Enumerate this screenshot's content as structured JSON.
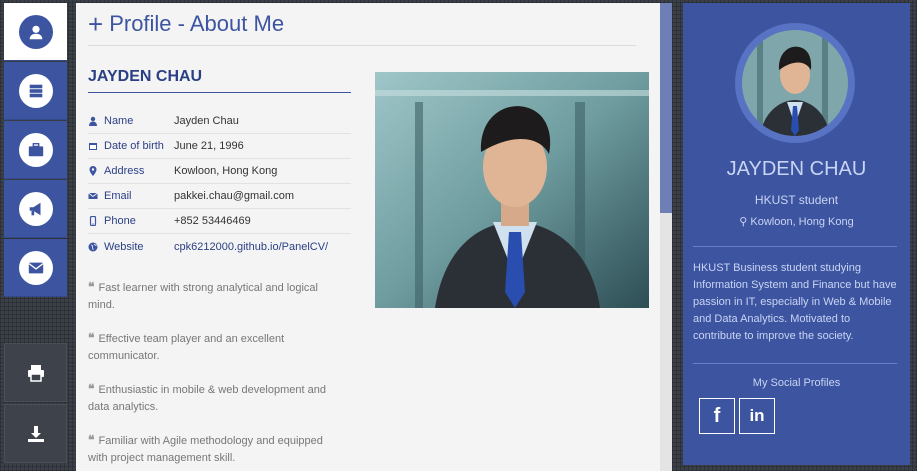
{
  "header": {
    "title": "Profile - About Me"
  },
  "profile": {
    "name": "JAYDEN CHAU",
    "fields": [
      {
        "icon": "user-icon",
        "label": "Name",
        "value": "Jayden Chau"
      },
      {
        "icon": "calendar-icon",
        "label": "Date of birth",
        "value": "June 21, 1996"
      },
      {
        "icon": "map-marker-icon",
        "label": "Address",
        "value": "Kowloon, Hong Kong"
      },
      {
        "icon": "envelope-icon",
        "label": "Email",
        "value": "pakkei.chau@gmail.com"
      },
      {
        "icon": "mobile-icon",
        "label": "Phone",
        "value": "+852 53446469"
      },
      {
        "icon": "globe-icon",
        "label": "Website",
        "value": "cpk6212000.github.io/PanelCV/"
      }
    ],
    "highlights": [
      "Fast learner with strong analytical and logical mind.",
      "Effective team player and an excellent communicator.",
      "Enthusiastic in mobile & web development and data analytics.",
      "Familiar with Agile methodology and equipped with project management skill."
    ]
  },
  "sidebar": {
    "name": "JAYDEN CHAU",
    "role": "HKUST student",
    "location": "Kowloon, Hong Kong",
    "bio": "HKUST Business student studying Information System and Finance but have passion in IT, especially in Web & Mobile and Data Analytics. Motivated to contribute to improve the society.",
    "social_title": "My Social Profiles",
    "social": [
      {
        "icon": "facebook-icon",
        "glyph": "f"
      },
      {
        "icon": "linkedin-icon",
        "glyph": "in"
      }
    ]
  },
  "nav": {
    "items": [
      "user-icon",
      "server-icon",
      "briefcase-icon",
      "megaphone-icon",
      "envelope-icon"
    ],
    "tools": [
      "print-icon",
      "download-icon"
    ]
  },
  "colors": {
    "accent": "#3d55a0",
    "background": "#3b3f47",
    "panel": "#f4f4f4"
  }
}
